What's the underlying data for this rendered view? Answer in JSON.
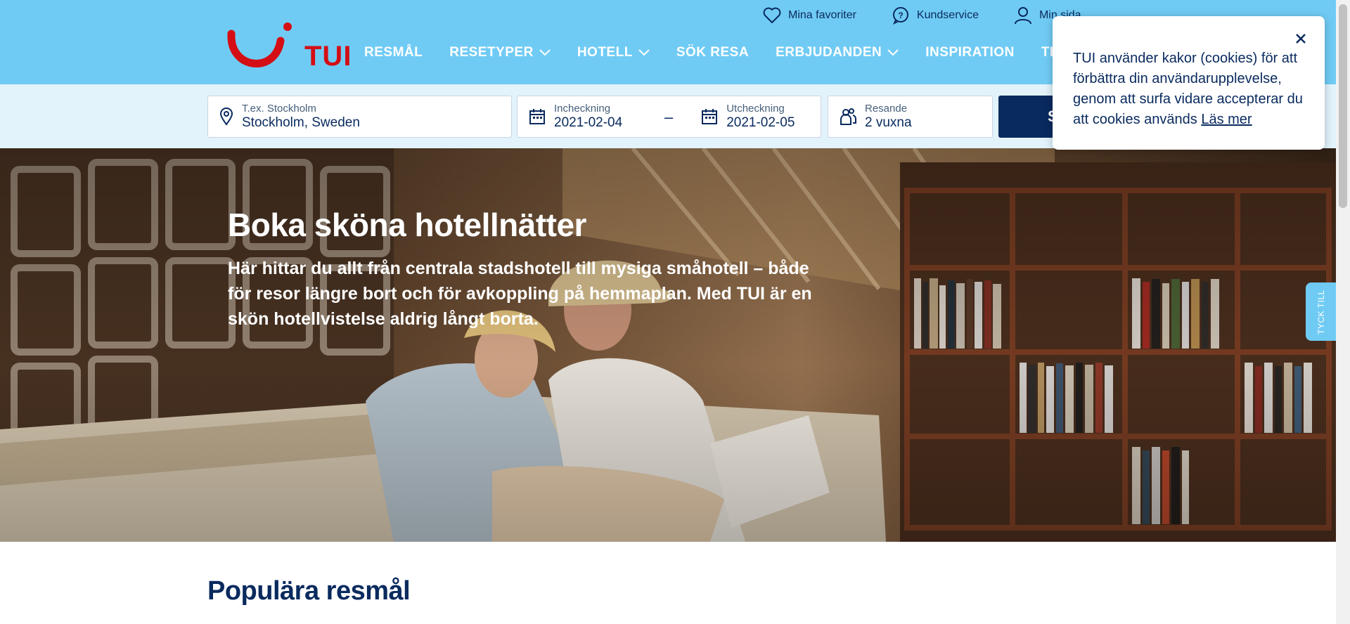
{
  "utility_nav": {
    "favorites": "Mina favoriter",
    "customer_service": "Kundservice",
    "my_page": "Min sida"
  },
  "brand": {
    "logo_text": "TUI",
    "accent": "#d40e14",
    "header_bg": "#70cbf4",
    "navy": "#092a5e"
  },
  "main_nav": {
    "items": [
      {
        "label": "RESMÅL",
        "dropdown": false
      },
      {
        "label": "RESETYPER",
        "dropdown": true
      },
      {
        "label": "HOTELL",
        "dropdown": true
      },
      {
        "label": "SÖK RESA",
        "dropdown": false
      },
      {
        "label": "ERBJUDANDEN",
        "dropdown": true
      },
      {
        "label": "INSPIRATION",
        "dropdown": false
      },
      {
        "label": "TILLV",
        "dropdown": false
      }
    ]
  },
  "search": {
    "destination": {
      "label": "T.ex. Stockholm",
      "value": "Stockholm, Sweden"
    },
    "checkin": {
      "label": "Incheckning",
      "value": "2021-02-04"
    },
    "separator": "–",
    "checkout": {
      "label": "Utcheckning",
      "value": "2021-02-05"
    },
    "travelers": {
      "label": "Resande",
      "value": "2 vuxna"
    },
    "button_label": "S"
  },
  "hero": {
    "title": "Boka sköna hotellnätter",
    "text": "Här hittar du allt från centrala stadshotell till mysiga småhotell – både för resor längre bort och för avkoppling på hemmaplan. Med TUI är en skön hotellvistelse aldrig långt borta."
  },
  "popular": {
    "title": "Populära resmål"
  },
  "cookie": {
    "text": "TUI använder kakor (cookies) för att förbättra din användarupplevelse, genom att surfa vidare accepterar du att cookies används",
    "link": "Läs mer"
  },
  "feedback": {
    "label": "TYCK TILL"
  }
}
